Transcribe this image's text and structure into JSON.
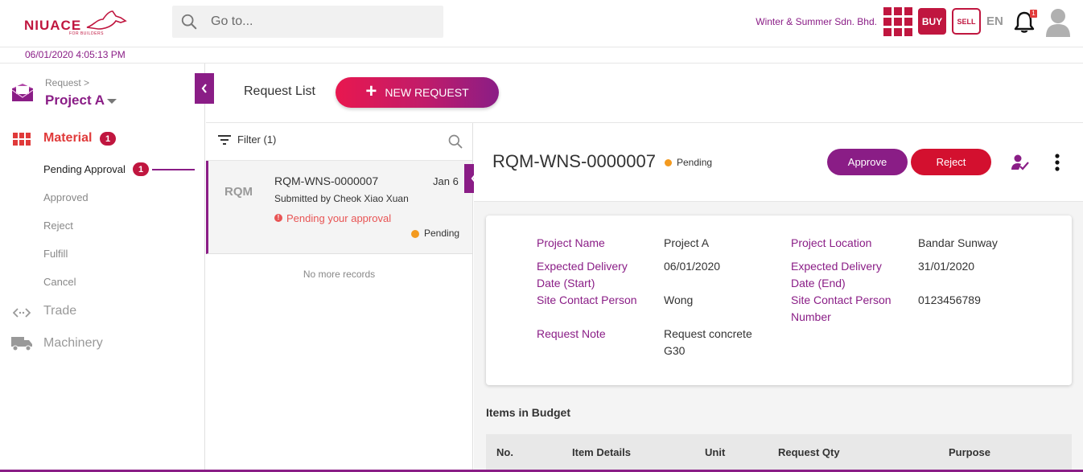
{
  "header": {
    "logo_text": "NIUACE",
    "logo_sub": "FOR BUILDERS",
    "search_placeholder": "Go to...",
    "company": "Winter & Summer Sdn. Bhd.",
    "buy_label": "BUY",
    "sell_label": "SELL",
    "language": "EN",
    "notification_count": "1"
  },
  "datetime": "06/01/2020 4:05:13 PM",
  "sidebar": {
    "breadcrumb": "Request >",
    "project": "Project A",
    "material_label": "Material",
    "material_count": "1",
    "sub_items": [
      {
        "label": "Pending Approval",
        "count": "1"
      },
      {
        "label": "Approved"
      },
      {
        "label": "Reject"
      },
      {
        "label": "Fulfill"
      },
      {
        "label": "Cancel"
      }
    ],
    "trade_label": "Trade",
    "machinery_label": "Machinery"
  },
  "main": {
    "title": "Request List",
    "new_request_label": "NEW REQUEST"
  },
  "list": {
    "filter_label": "Filter (1)",
    "card": {
      "abbr": "RQM",
      "id": "RQM-WNS-0000007",
      "date": "Jan 6",
      "submitted_by": "Submitted by Cheok Xiao Xuan",
      "warning": "Pending your approval",
      "status": "Pending"
    },
    "empty_text": "No more records"
  },
  "detail": {
    "id": "RQM-WNS-0000007",
    "status": "Pending",
    "approve_label": "Approve",
    "reject_label": "Reject",
    "fields": {
      "project_name_label": "Project Name",
      "project_name": "Project A",
      "project_location_label": "Project Location",
      "project_location": "Bandar Sunway",
      "delivery_start_label_1": "Expected Delivery",
      "delivery_start_label_2": "Date (Start)",
      "delivery_start": "06/01/2020",
      "delivery_end_label_1": "Expected Delivery",
      "delivery_end_label_2": "Date (End)",
      "delivery_end": "31/01/2020",
      "site_contact_label": "Site Contact Person",
      "site_contact": "Wong",
      "site_contact_number_label_1": "Site Contact Person",
      "site_contact_number_label_2": "Number",
      "site_contact_number": "0123456789",
      "request_note_label": "Request Note",
      "request_note_1": "Request concrete",
      "request_note_2": "G30"
    },
    "items_title": "Items in Budget",
    "table_headers": [
      "No.",
      "Item Details",
      "Unit",
      "Request Qty",
      "Purpose"
    ]
  },
  "colors": {
    "brand_purple": "#8a1d86",
    "brand_red": "#c0163f",
    "pending_orange": "#f39a1f",
    "warning_red": "#e85454"
  }
}
